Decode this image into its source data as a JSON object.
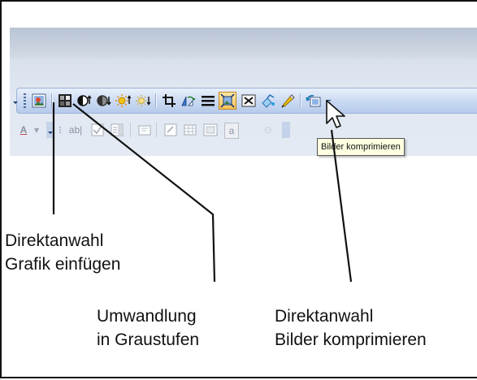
{
  "tooltip": {
    "text": "Bilder komprimieren"
  },
  "format_toolbar": {
    "font_color_label": "A",
    "textfield_label": "ab|",
    "small_label": "a"
  },
  "annotations": {
    "grafik_einfuegen": {
      "line1": "Direktanwahl",
      "line2": "Grafik einfügen"
    },
    "graustufen": {
      "line1": "Umwandlung",
      "line2": "in Graustufen"
    },
    "bilder_komprimieren": {
      "line1": "Direktanwahl",
      "line2": "Bilder komprimieren"
    }
  },
  "icons": [
    "insert-picture-icon",
    "color-grayscale-icon",
    "more-contrast-icon",
    "less-contrast-icon",
    "more-brightness-icon",
    "less-brightness-icon",
    "crop-icon",
    "rotate-icon",
    "line-style-icon",
    "compress-pictures-icon",
    "text-wrapping-icon",
    "format-picture-icon",
    "set-transparent-color-icon",
    "reset-picture-icon"
  ],
  "colors": {
    "toolbar_blue": "#c9d9f2",
    "tooltip_bg": "#ffffe1",
    "highlight_orange": "#f5c25b"
  }
}
